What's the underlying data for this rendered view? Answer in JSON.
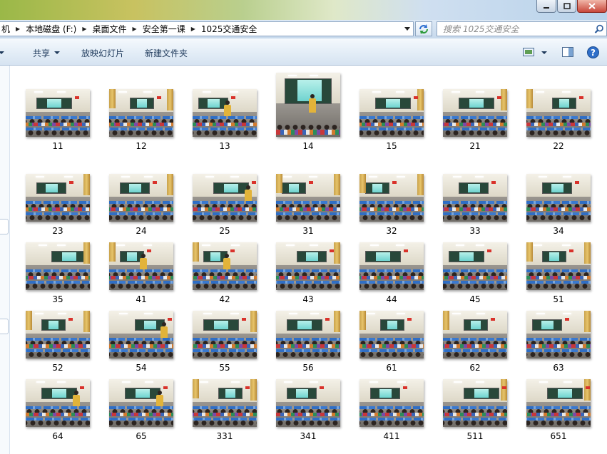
{
  "address": {
    "crumbs": [
      "机",
      "本地磁盘 (F:)",
      "桌面文件",
      "安全第一课",
      "1025交通安全"
    ]
  },
  "search": {
    "placeholder": "搜索 1025交通安全"
  },
  "toolbar": {
    "share_label": "共享",
    "slideshow_label": "放映幻灯片",
    "new_folder_label": "新建文件夹"
  },
  "files": [
    {
      "name": "11"
    },
    {
      "name": "12"
    },
    {
      "name": "13"
    },
    {
      "name": "14"
    },
    {
      "name": "15"
    },
    {
      "name": "21"
    },
    {
      "name": "22"
    },
    {
      "name": "23"
    },
    {
      "name": "24"
    },
    {
      "name": "25"
    },
    {
      "name": "31"
    },
    {
      "name": "32"
    },
    {
      "name": "33"
    },
    {
      "name": "34"
    },
    {
      "name": "35"
    },
    {
      "name": "41"
    },
    {
      "name": "42"
    },
    {
      "name": "43"
    },
    {
      "name": "44"
    },
    {
      "name": "45"
    },
    {
      "name": "51"
    },
    {
      "name": "52"
    },
    {
      "name": "54"
    },
    {
      "name": "55"
    },
    {
      "name": "56"
    },
    {
      "name": "61"
    },
    {
      "name": "62"
    },
    {
      "name": "63"
    },
    {
      "name": "64"
    },
    {
      "name": "65"
    },
    {
      "name": "331"
    },
    {
      "name": "341"
    },
    {
      "name": "411"
    },
    {
      "name": "511"
    },
    {
      "name": "651"
    }
  ],
  "colors": {
    "toolbar_text": "#1e395b",
    "classroom_screen": "#7ad8d2",
    "desk_blue": "#2f6ec5"
  },
  "icons": {
    "window": [
      "minimize-icon",
      "maximize-icon",
      "close-icon"
    ],
    "address": [
      "chevron-right-icon",
      "dropdown-arrow-icon",
      "refresh-icon",
      "search-icon"
    ],
    "toolbar": [
      "view-options-icon",
      "preview-pane-icon",
      "help-icon"
    ]
  }
}
